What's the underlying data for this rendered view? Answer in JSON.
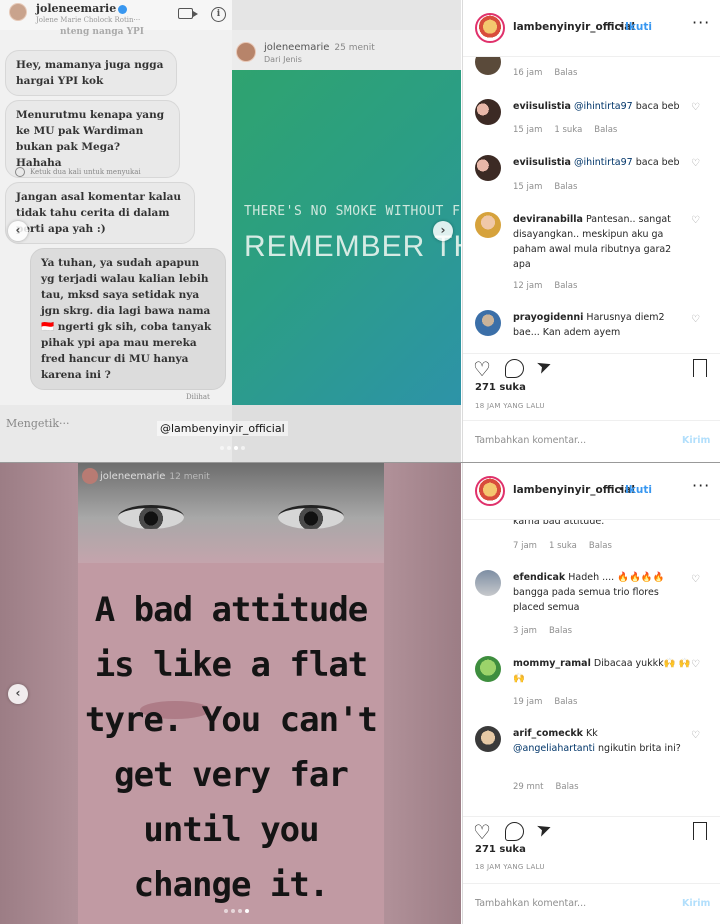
{
  "post1": {
    "chat": {
      "name": "joleneemarie",
      "subtitle": "Jolene Marie Cholock Rotin···",
      "top_fragment": "nteng nanga YPI",
      "bubbles": [
        "Hey, mamanya juga ngga hargai YPI kok",
        "Menurutmu kenapa yang ke MU pak Wardiman bukan pak Mega? Hahaha",
        "Jangan asal komentar kalau tidak tahu cerita di dalam        perti apa yah :)",
        "Ya tuhan, ya sudah apapun yg terjadi walau kalian lebih tau, mksd saya setidak nya jgn skrg. dia lagi bawa nama 🇮🇩 ngerti gk sih, coba tanyak pihak ypi apa mau mereka fred hancur di MU hanya karena ini ?"
      ],
      "double_tap_hint": "Ketuk dua kali untuk menyukai",
      "seen": "Dilihat",
      "typing_placeholder": "Mengetik···"
    },
    "story": {
      "name": "joleneemarie",
      "time": "25 menit",
      "from": "Dari Jenis",
      "line1": "THERE'S NO SMOKE WITHOUT FIRE.",
      "line2": "REMEMBER THAT"
    },
    "watermark": "@lambenyinyir_official",
    "sidebar": {
      "username": "lambenyinyir_official",
      "dot": "•",
      "follow": "Ikuti",
      "more": "···",
      "comments": [
        {
          "user": "",
          "text": "",
          "time": "16 jam",
          "likes": "",
          "reply": "Balas"
        },
        {
          "user": "eviisulistia",
          "mention": "@ihintirta97",
          "text": " baca beb",
          "time": "15 jam",
          "likes": "1 suka",
          "reply": "Balas"
        },
        {
          "user": "eviisulistia",
          "mention": "@ihintirta97",
          "text": " baca beb",
          "time": "15 jam",
          "likes": "",
          "reply": "Balas"
        },
        {
          "user": "deviranabilla",
          "mention": "",
          "text": " Pantesan.. sangat disayangkan.. meskipun aku ga paham awal mula ributnya gara2 apa",
          "time": "12 jam",
          "likes": "",
          "reply": "Balas"
        },
        {
          "user": "prayogidenni",
          "mention": "",
          "text": " Harusnya diem2 bae... Kan adem ayem",
          "time": "",
          "likes": "",
          "reply": ""
        }
      ],
      "likes": "271 suka",
      "time_ago": "18 JAM YANG LALU",
      "add_comment_placeholder": "Tambahkan komentar...",
      "post_button": "Kirim"
    }
  },
  "post2": {
    "header_name": "joleneemarie",
    "header_time": "12 menit",
    "quote": "A bad attitude is like a flat tyre. You can't get very far until you change it.",
    "sidebar": {
      "username": "lambenyinyir_official",
      "dot": "•",
      "follow": "Ikuti",
      "more": "···",
      "comments": [
        {
          "user": "",
          "mention": "",
          "text": "karna bad attitude.",
          "time": "7 jam",
          "likes": "1 suka",
          "reply": "Balas"
        },
        {
          "user": "efendicak",
          "mention": "",
          "text": " Hadeh .... 🔥🔥🔥🔥 bangga pada semua trio flores placed semua",
          "time": "3 jam",
          "likes": "",
          "reply": "Balas"
        },
        {
          "user": "mommy_ramal",
          "mention": "",
          "text": " Dibacaa yukkk🙌 🙌🙌",
          "time": "19 jam",
          "likes": "",
          "reply": "Balas"
        },
        {
          "user": "arif_comeckk",
          "mention": "@angeliahartanti",
          "text": " ngikutin brita ini?",
          "time": "29 mnt",
          "likes": "",
          "reply": "Balas",
          "prefix": " Kk"
        }
      ],
      "likes": "271 suka",
      "time_ago": "18 JAM YANG LALU",
      "add_comment_placeholder": "Tambahkan komentar...",
      "post_button": "Kirim"
    }
  },
  "icons": {
    "like": "heart-icon",
    "comment": "comment-icon",
    "share": "share-icon",
    "save": "bookmark-icon",
    "prev": "chevron-left-icon",
    "next": "chevron-right-icon"
  },
  "colors": {
    "accent": "#3897f0",
    "muted": "#8e8e8e",
    "story_green": "#2fa36f",
    "quote_pink": "#c19aa3"
  }
}
